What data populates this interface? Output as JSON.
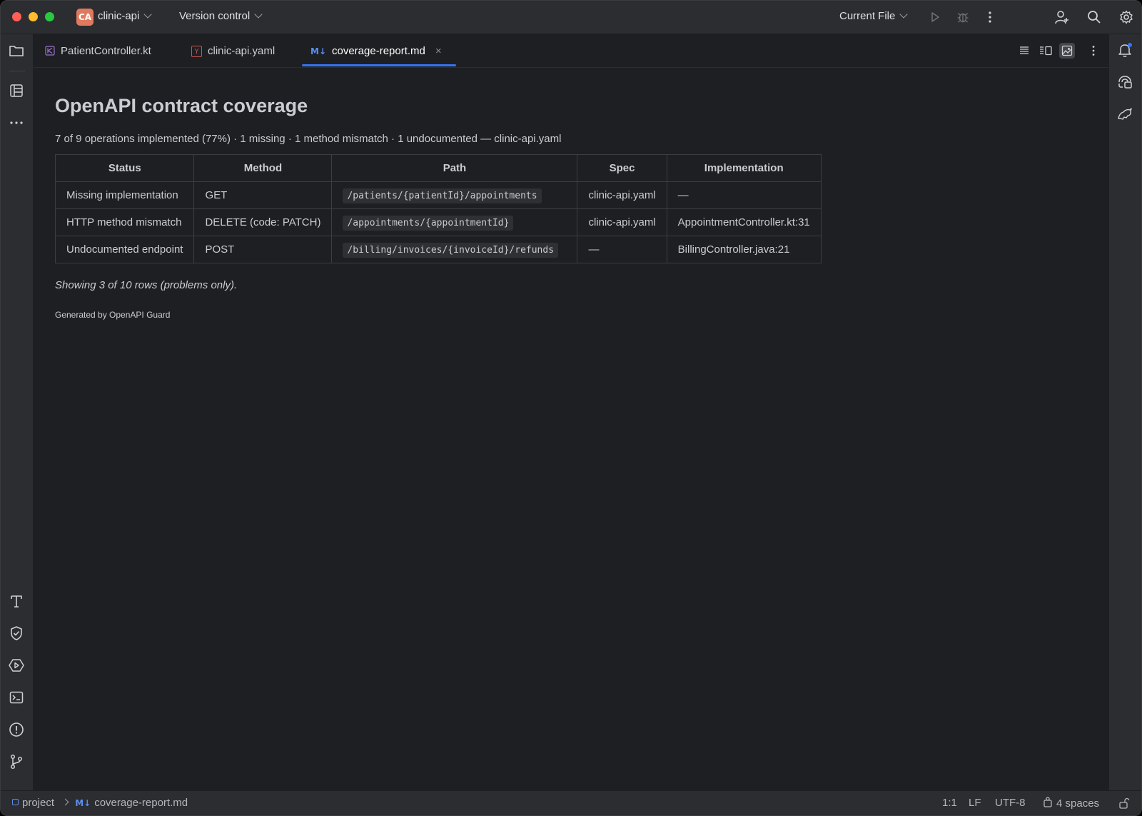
{
  "titlebar": {
    "project_badge": "CA",
    "project_name": "clinic-api",
    "vcs_label": "Version control",
    "run_config": "Current File"
  },
  "tabs": [
    {
      "label": "PatientController.kt",
      "icon": "kotlin-file-icon"
    },
    {
      "label": "clinic-api.yaml",
      "icon": "yaml-file-icon"
    },
    {
      "label": "coverage-report.md",
      "icon": "markdown-file-icon",
      "active": true
    }
  ],
  "markdown_icon_text": "M↓",
  "yaml_icon_text": "Y",
  "tab_close": "×",
  "doc": {
    "title": "OpenAPI contract coverage",
    "summary": "7 of 9 operations implemented (77%) · 1 missing · 1 method mismatch · 1 undocumented — clinic-api.yaml",
    "table": {
      "headers": [
        "Status",
        "Method",
        "Path",
        "Spec",
        "Implementation"
      ],
      "rows": [
        [
          "Missing implementation",
          "GET",
          "/patients/{patientId}/appointments",
          "clinic-api.yaml",
          "—"
        ],
        [
          "HTTP method mismatch",
          "DELETE (code: PATCH)",
          "/appointments/{appointmentId}",
          "clinic-api.yaml",
          "AppointmentController.kt:31"
        ],
        [
          "Undocumented endpoint",
          "POST",
          "/billing/invoices/{invoiceId}/refunds",
          "—",
          "BillingController.java:21"
        ]
      ]
    },
    "note": "Showing 3 of 10 rows (problems only).",
    "generated_by": "Generated by OpenAPI Guard"
  },
  "statusbar": {
    "breadcrumb_root": "project",
    "breadcrumb_file": "coverage-report.md",
    "position": "1:1",
    "line_ending": "LF",
    "encoding": "UTF-8",
    "indent": "4 spaces"
  },
  "colors": {
    "accent": "#3574f0",
    "background": "#1e1f22",
    "panel": "#2b2d30"
  }
}
